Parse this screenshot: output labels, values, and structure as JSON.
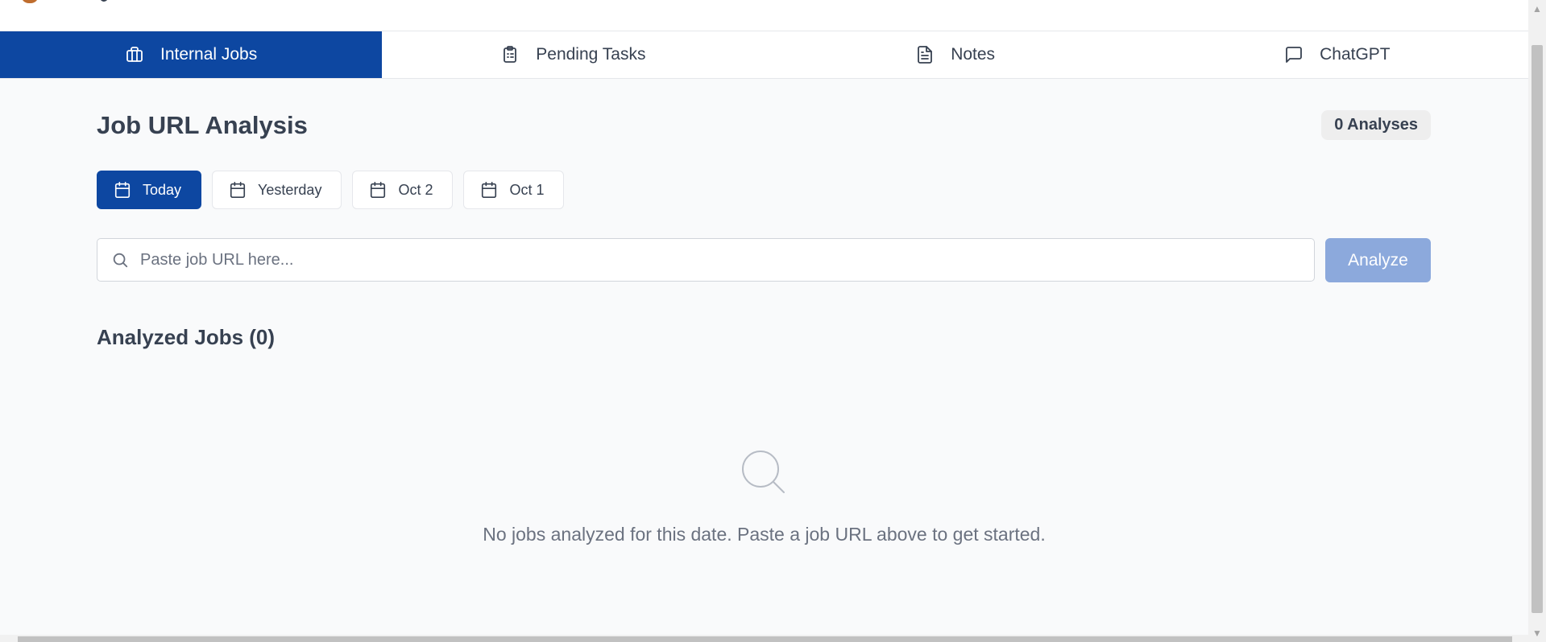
{
  "nav": {
    "tabs": [
      {
        "label": "Internal Jobs",
        "icon": "briefcase-icon",
        "active": true
      },
      {
        "label": "Pending Tasks",
        "icon": "clipboard-icon",
        "active": false
      },
      {
        "label": "Notes",
        "icon": "document-icon",
        "active": false
      },
      {
        "label": "ChatGPT",
        "icon": "chat-bubble-icon",
        "active": false
      }
    ]
  },
  "main": {
    "title": "Job URL Analysis",
    "count_badge": "0 Analyses",
    "date_filters": [
      {
        "label": "Today",
        "icon": "calendar-icon",
        "active": true
      },
      {
        "label": "Yesterday",
        "icon": "calendar-icon",
        "active": false
      },
      {
        "label": "Oct 2",
        "icon": "calendar-icon",
        "active": false
      },
      {
        "label": "Oct 1",
        "icon": "calendar-icon",
        "active": false
      }
    ],
    "search": {
      "placeholder": "Paste job URL here...",
      "value": "",
      "icon": "search-icon"
    },
    "analyze_label": "Analyze",
    "section_title": "Analyzed Jobs (0)",
    "empty_state": {
      "icon": "search-icon",
      "message": "No jobs analyzed for this date. Paste a job URL above to get started."
    }
  },
  "colors": {
    "primary": "#0d47a1",
    "analyze_disabled": "#8ca9dc",
    "background": "#f9fafb"
  }
}
